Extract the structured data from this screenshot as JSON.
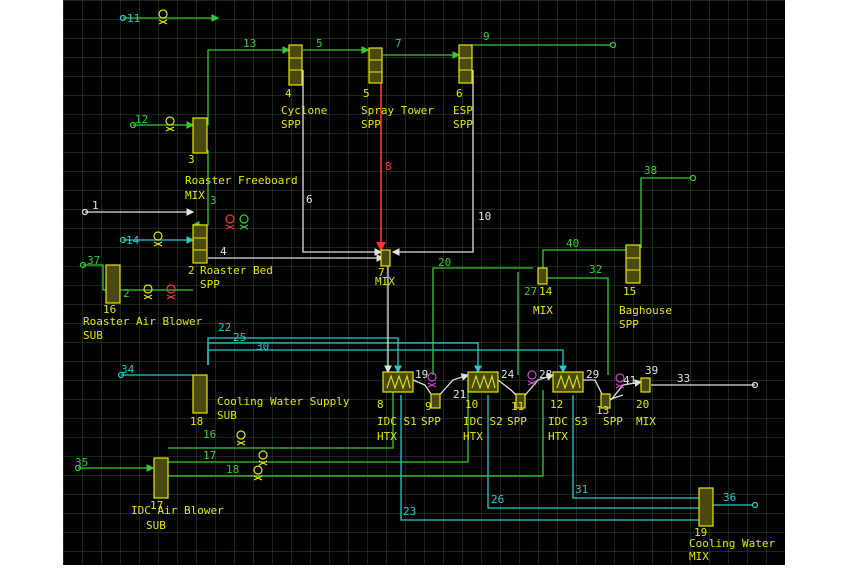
{
  "colors": {
    "background": "#000000",
    "grid": "#2f4f2f",
    "unit_outline": "#e6e600",
    "unit_fill": "#4a4a10",
    "label": "#e6e600",
    "air_stream": "#33cc33",
    "water_stream": "#22cccc",
    "process_stream": "#e0e0e0",
    "hot_stream": "#ff3333",
    "valve_magenta": "#cc44cc"
  },
  "units": {
    "cyclone": {
      "number": "4",
      "name": "Cyclone",
      "type": "SPP"
    },
    "spray_tower": {
      "number": "5",
      "name": "Spray Tower",
      "type": "SPP"
    },
    "esp": {
      "number": "6",
      "name": "ESP",
      "type": "SPP"
    },
    "roaster_freeboard": {
      "number": "3",
      "name": "Roaster Freeboard",
      "type": "MIX"
    },
    "roaster_bed": {
      "number": "2",
      "name": "Roaster Bed",
      "type": "SPP"
    },
    "roaster_air_blower": {
      "number": "16",
      "name": "Roaster Air Blower",
      "type": "SUB"
    },
    "mix7": {
      "number": "7",
      "name": "",
      "type": "MIX"
    },
    "mix14": {
      "number": "14",
      "name": "",
      "type": "MIX"
    },
    "baghouse": {
      "number": "15",
      "name": "Baghouse",
      "type": "SPP"
    },
    "cooling_water_supply": {
      "number": "18",
      "name": "Cooling Water Supply",
      "type": "SUB"
    },
    "idc_s1": {
      "number": "8",
      "name": "IDC S1",
      "type": "HTX"
    },
    "spp9": {
      "number": "9",
      "name": "",
      "type": "SPP"
    },
    "idc_s2": {
      "number": "10",
      "name": "IDC S2",
      "type": "HTX"
    },
    "spp11": {
      "number": "11",
      "name": "",
      "type": "SPP"
    },
    "idc_s3": {
      "number": "12",
      "name": "IDC S3",
      "type": "HTX"
    },
    "spp13": {
      "number": "13",
      "name": "",
      "type": "SPP"
    },
    "mix20": {
      "number": "20",
      "name": "",
      "type": "MIX"
    },
    "idc_air_blower": {
      "number": "17",
      "name": "IDC Air Blower",
      "type": "SUB"
    },
    "cooling_water_mix": {
      "number": "19",
      "name": "Cooling Water",
      "type": "MIX"
    }
  },
  "stream_labels": {
    "s1": "1",
    "s2": "2",
    "s3": "3",
    "s4": "4",
    "s5": "5",
    "s6": "6",
    "s7": "7",
    "s8": "8",
    "s9": "9",
    "s10": "10",
    "s11": "11",
    "s12": "12",
    "s13": "13",
    "s14": "14",
    "s16": "16",
    "s17": "17",
    "s18": "18",
    "s19": "19",
    "s20": "20",
    "s21": "21",
    "s22": "22",
    "s23": "23",
    "s24": "24",
    "s25": "25",
    "s26": "26",
    "s27": "27",
    "s28": "28",
    "s29": "29",
    "s30": "30",
    "s31": "31",
    "s32": "32",
    "s33": "33",
    "s34": "34",
    "s35": "35",
    "s36": "36",
    "s37": "37",
    "s38": "38",
    "s39": "39",
    "s40": "40",
    "s41": "41"
  }
}
